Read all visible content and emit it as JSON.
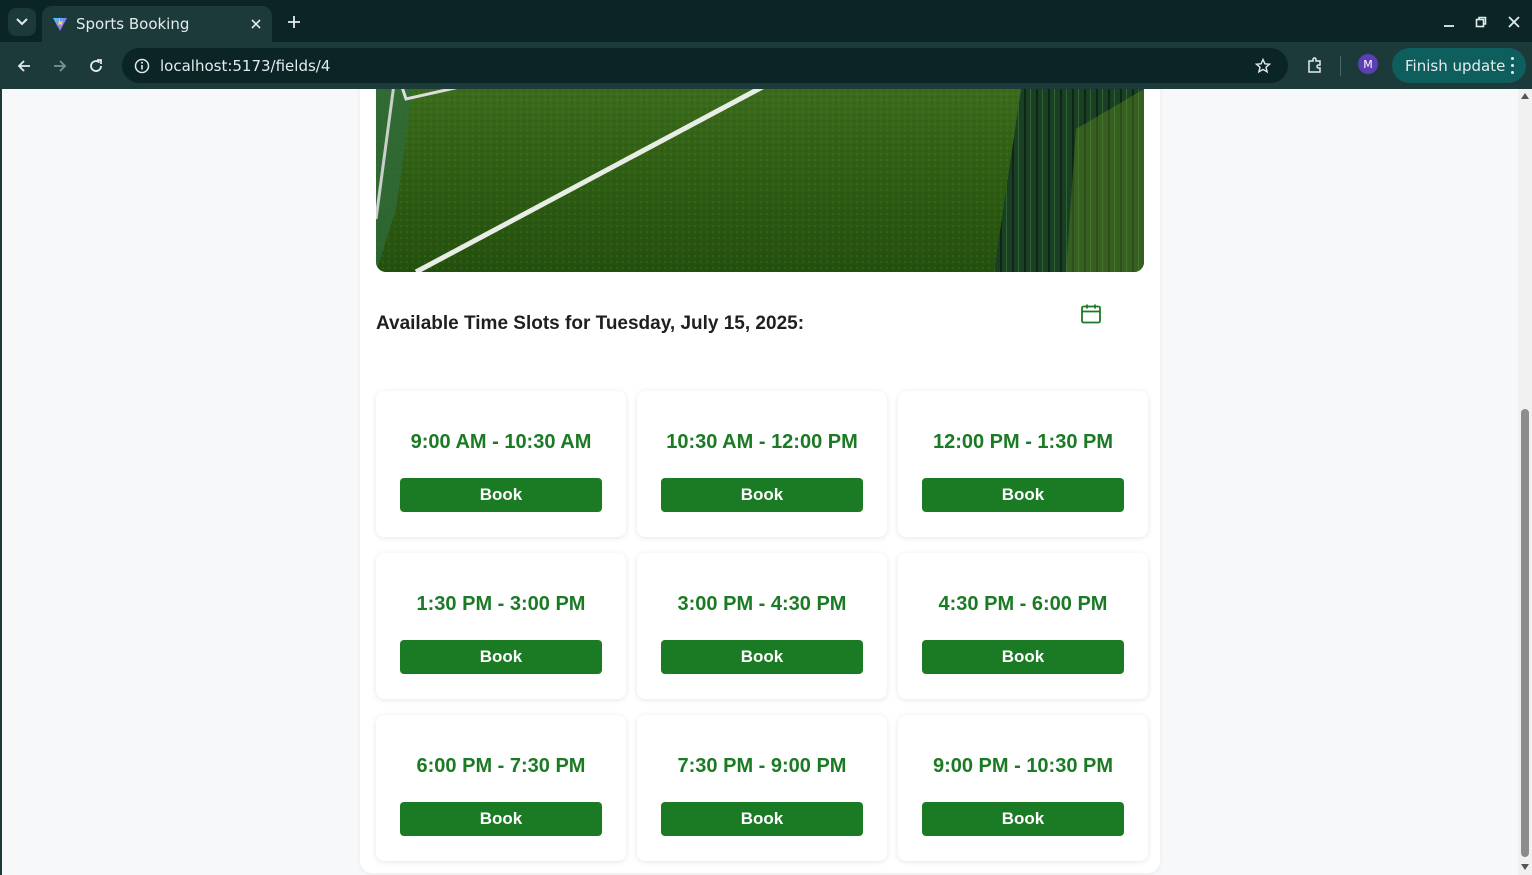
{
  "browser": {
    "tab_title": "Sports Booking",
    "url": "localhost:5173/fields/4",
    "profile_initial": "M",
    "update_label": "Finish update"
  },
  "page": {
    "slots_heading": "Available Time Slots for Tuesday, July 15, 2025:",
    "slots": [
      {
        "time": "9:00 AM - 10:30 AM",
        "button": "Book"
      },
      {
        "time": "10:30 AM - 12:00 PM",
        "button": "Book"
      },
      {
        "time": "12:00 PM - 1:30 PM",
        "button": "Book"
      },
      {
        "time": "1:30 PM - 3:00 PM",
        "button": "Book"
      },
      {
        "time": "3:00 PM - 4:30 PM",
        "button": "Book"
      },
      {
        "time": "4:30 PM - 6:00 PM",
        "button": "Book"
      },
      {
        "time": "6:00 PM - 7:30 PM",
        "button": "Book"
      },
      {
        "time": "7:30 PM - 9:00 PM",
        "button": "Book"
      },
      {
        "time": "9:00 PM - 10:30 PM",
        "button": "Book"
      }
    ]
  },
  "colors": {
    "accent_green": "#1b7a24",
    "chrome_dark": "#0b2425",
    "chrome_toolbar": "#1d3a3b",
    "update_button": "#0f5e5e"
  },
  "icons": [
    "tab-list-icon",
    "vite-favicon-icon",
    "close-icon",
    "plus-icon",
    "minimize-icon",
    "restore-icon",
    "window-close-icon",
    "back-icon",
    "forward-icon",
    "reload-icon",
    "site-info-icon",
    "star-icon",
    "extensions-icon",
    "more-vert-icon",
    "calendar-icon"
  ]
}
